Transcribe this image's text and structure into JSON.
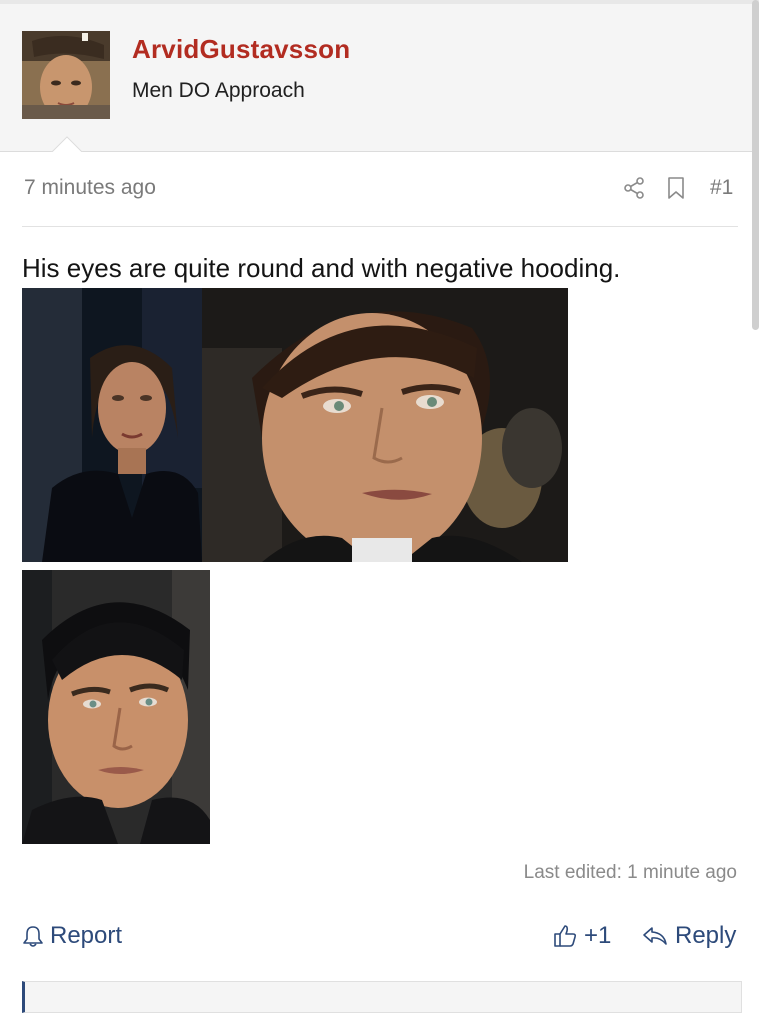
{
  "post": {
    "author": "ArvidGustavsson",
    "user_title": "Men DO Approach",
    "time": "7 minutes ago",
    "number": "#1",
    "body": "His eyes are quite round and with negative hooding.",
    "last_edited": "Last edited: 1 minute ago"
  },
  "actions": {
    "report": "Report",
    "like": "+1",
    "reply": "Reply"
  },
  "icons": [
    "bell-icon",
    "share-icon",
    "bookmark-icon",
    "thumbs-up-icon",
    "reply-arrow-icon"
  ],
  "colors": {
    "username": "#b22c21",
    "action": "#2d4a7a",
    "meta": "#7a7a7a"
  }
}
